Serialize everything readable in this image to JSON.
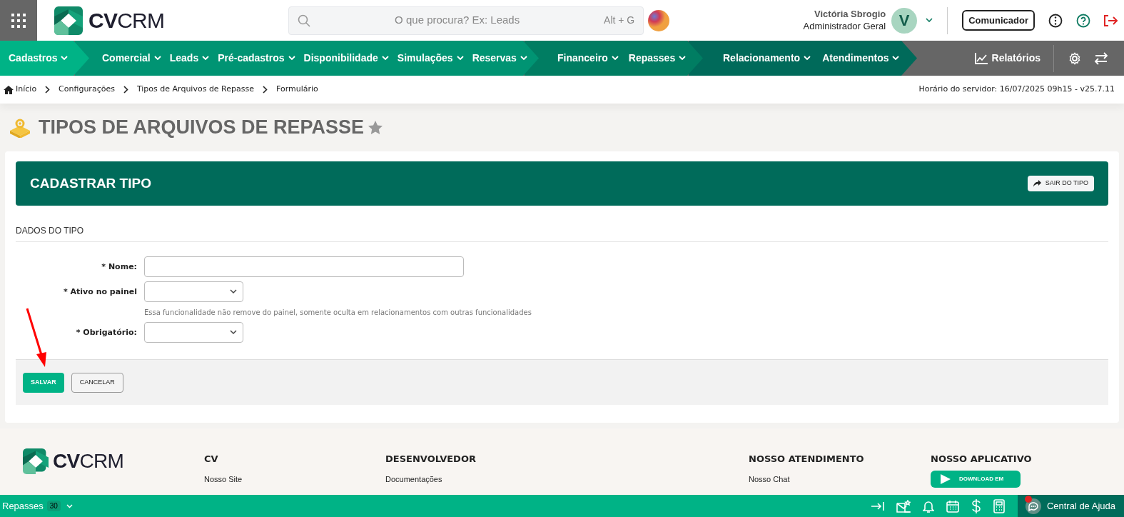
{
  "top_bar": {
    "logo": "**CV**CRM",
    "search": {
      "placeholder": "O que procura? Ex: Leads",
      "shortcut": "Alt + G"
    },
    "user": {
      "name": "Victória Sbrogio",
      "role": "Administrador Geral",
      "initial": "V"
    },
    "communicator_button": "Comunicador"
  },
  "nav": {
    "groups": [
      {
        "items": [
          "Cadastros"
        ]
      },
      {
        "items": [
          "Comercial",
          "Leads",
          "Pré-cadastros",
          "Disponibilidade",
          "Simulações",
          "Reservas"
        ]
      },
      {
        "items": [
          "Financeiro",
          "Repasses"
        ]
      },
      {
        "items": [
          "Relacionamento",
          "Atendimentos"
        ]
      }
    ],
    "reports": "Relatórios"
  },
  "breadcrumb": [
    "Início",
    "Configurações",
    "Tipos de Arquivos de Repasse",
    "Formulário"
  ],
  "server_time": "Horário do servidor: 16/07/2025 09h15 - v25.7.11",
  "page_title": "TIPOS DE ARQUIVOS DE REPASSE",
  "form": {
    "header": "CADASTRAR TIPO",
    "exit_button": "SAIR DO TIPO",
    "section": "DADOS DO TIPO",
    "fields": [
      {
        "kind": "text",
        "label": "* Nome:"
      },
      {
        "kind": "select",
        "label": "* Ativo no painel",
        "help": "Essa funcionalidade não remove do painel, somente oculta em relacionamentos com outras funcionalidades"
      },
      {
        "kind": "select",
        "label": "* Obrigatório:"
      }
    ],
    "buttons": [
      {
        "kind": "primary",
        "label": "SALVAR"
      },
      {
        "kind": "secondary",
        "label": "CANCELAR"
      }
    ]
  },
  "footer": {
    "logo": "**CV**CRM",
    "columns": [
      {
        "title": "CV",
        "links": [
          "Nosso Site"
        ]
      },
      {
        "title": "DESENVOLVEDOR",
        "links": [
          "Documentações"
        ]
      },
      {
        "title": "NOSSO ATENDIMENTO",
        "links": [
          "Nosso Chat"
        ]
      },
      {
        "title": "NOSSO APLICATIVO",
        "badge": "DOWNLOAD EM"
      }
    ]
  },
  "bottom_bar": {
    "module": "Repasses",
    "count": "30",
    "help": "Central de Ajuda"
  }
}
